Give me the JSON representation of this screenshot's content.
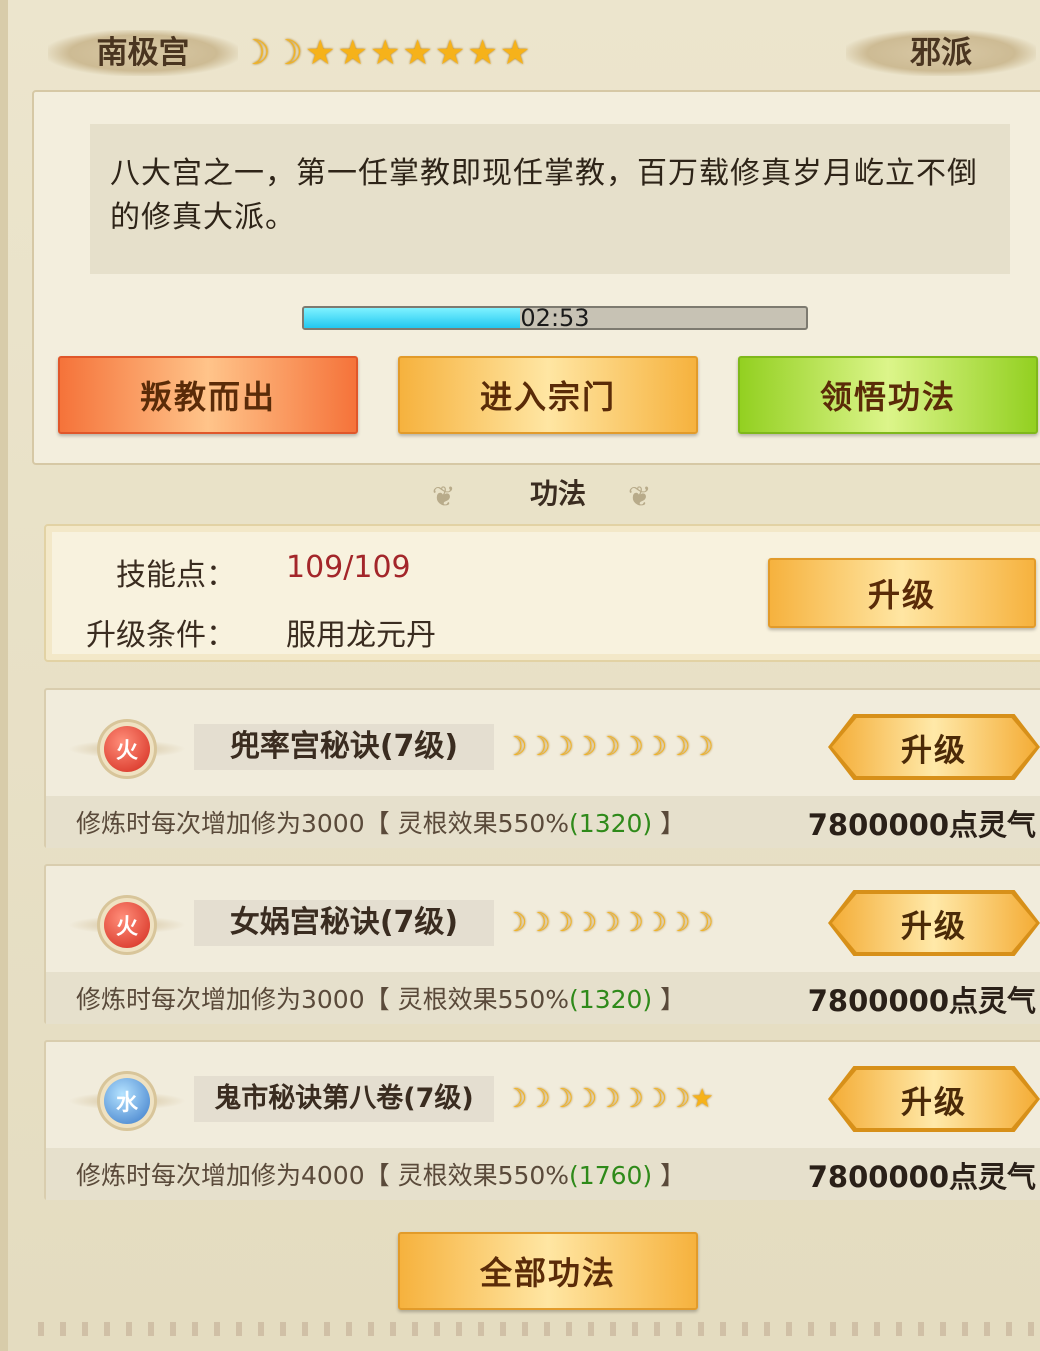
{
  "header": {
    "sect_name": "南极宫",
    "alignment": "邪派",
    "rank": [
      "moon",
      "moon",
      "star",
      "star",
      "star",
      "star",
      "star",
      "star",
      "star"
    ]
  },
  "intro": {
    "description": "八大宫之一，第一任掌教即现任掌教，百万载修真岁月屹立不倒的修真大派。",
    "timer": "02:53",
    "timer_progress": 0.43,
    "buttons": {
      "betray": "叛教而出",
      "enter": "进入宗门",
      "comprehend": "领悟功法"
    }
  },
  "section_title": "功法",
  "skill_points": {
    "label": "技能点：",
    "value": "109/109",
    "condition_label": "升级条件：",
    "condition_value": "服用龙元丹",
    "upgrade_label": "升级"
  },
  "skills": [
    {
      "element": "火",
      "name": "兜率宫秘诀(7级)",
      "rank": [
        "moon",
        "moon",
        "moon",
        "moon",
        "moon",
        "moon",
        "moon",
        "moon",
        "moon"
      ],
      "desc_prefix": "修炼时每次增加修为3000【 灵根效果550%",
      "desc_bonus": "(1320)",
      "desc_suffix": " 】",
      "cost": "7800000点灵气",
      "upgrade_label": "升级"
    },
    {
      "element": "火",
      "name": "女娲宫秘诀(7级)",
      "rank": [
        "moon",
        "moon",
        "moon",
        "moon",
        "moon",
        "moon",
        "moon",
        "moon",
        "moon"
      ],
      "desc_prefix": "修炼时每次增加修为3000【 灵根效果550%",
      "desc_bonus": "(1320)",
      "desc_suffix": " 】",
      "cost": "7800000点灵气",
      "upgrade_label": "升级"
    },
    {
      "element": "水",
      "name": "鬼市秘诀第八卷(7级)",
      "rank": [
        "moon",
        "moon",
        "moon",
        "moon",
        "moon",
        "moon",
        "moon",
        "moon",
        "star"
      ],
      "desc_prefix": "修炼时每次增加修为4000【 灵根效果550%",
      "desc_bonus": "(1760)",
      "desc_suffix": " 】",
      "cost": "7800000点灵气",
      "upgrade_label": "升级"
    }
  ],
  "all_skills_label": "全部功法",
  "colors": {
    "accent_orange": "#f6b23e",
    "accent_red": "#f5733a",
    "accent_green": "#93d021",
    "bonus_green": "#2f8a1a",
    "skill_point_red": "#a3262a"
  }
}
